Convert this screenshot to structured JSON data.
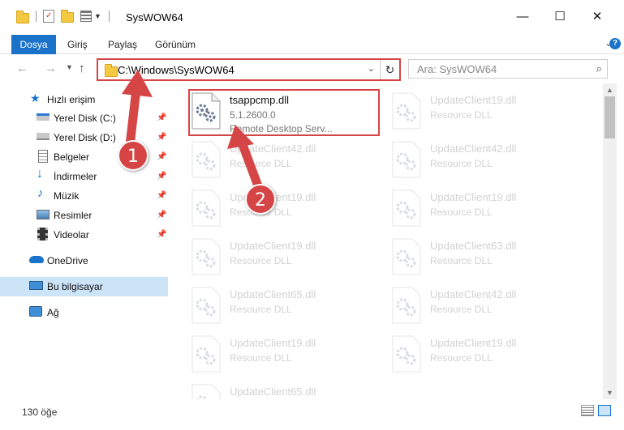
{
  "window": {
    "title": "SysWOW64",
    "minimize_glyph": "—",
    "maximize_glyph": "☐",
    "close_glyph": "✕"
  },
  "ribbon": {
    "tabs": [
      {
        "label": "Dosya",
        "active": true
      },
      {
        "label": "Giriş"
      },
      {
        "label": "Paylaş"
      },
      {
        "label": "Görünüm"
      }
    ],
    "expand_glyph": "⌄",
    "help_glyph": "?"
  },
  "nav": {
    "address": "C:\\Windows\\SysWOW64",
    "search_placeholder": "Ara: SysWOW64"
  },
  "sidebar": {
    "items": [
      {
        "label": "Hızlı erişim",
        "icon": "star-icon"
      },
      {
        "label": "Yerel Disk (C:)",
        "icon": "drive-icon",
        "pinned": true
      },
      {
        "label": "Yerel Disk (D:)",
        "icon": "drive-icon",
        "pinned": true
      },
      {
        "label": "Belgeler",
        "icon": "document-icon",
        "pinned": true
      },
      {
        "label": "İndirmeler",
        "icon": "download-icon",
        "pinned": true
      },
      {
        "label": "Müzik",
        "icon": "music-icon",
        "pinned": true
      },
      {
        "label": "Resimler",
        "icon": "pictures-icon",
        "pinned": true
      },
      {
        "label": "Videolar",
        "icon": "video-icon",
        "pinned": true
      },
      {
        "label": "OneDrive",
        "icon": "cloud-icon"
      },
      {
        "label": "Bu bilgisayar",
        "icon": "computer-icon",
        "selected": true
      },
      {
        "label": "Ağ",
        "icon": "network-icon"
      }
    ]
  },
  "files": {
    "highlighted": {
      "name": "tsappcmp.dll",
      "version": "5.1.2600.0",
      "description": "Remote Desktop Serv..."
    },
    "ghost": [
      {
        "name": "UpdateClient19.dll",
        "desc": "Resource DLL"
      },
      {
        "name": "UpdateClient42.dll",
        "desc": "Resource DLL"
      },
      {
        "name": "UpdateClient42.dll",
        "desc": "Resource DLL"
      },
      {
        "name": "UpdateClient19.dll",
        "desc": "Resource DLL"
      },
      {
        "name": "UpdateClient19.dll",
        "desc": "Resource DLL"
      },
      {
        "name": "UpdateClient19.dll",
        "desc": "Resource DLL"
      },
      {
        "name": "UpdateClient63.dll",
        "desc": "Resource DLL"
      },
      {
        "name": "UpdateClient65.dll",
        "desc": "Resource DLL"
      },
      {
        "name": "UpdateClient42.dll",
        "desc": "Resource DLL"
      },
      {
        "name": "UpdateClient19.dll",
        "desc": "Resource DLL"
      },
      {
        "name": "UpdateClient19.dll",
        "desc": "Resource DLL"
      },
      {
        "name": "UpdateClient65.dll",
        "desc": "Resource DLL"
      }
    ]
  },
  "status": {
    "count": "130 öğe"
  },
  "annotations": {
    "step1": "1",
    "step2": "2",
    "color": "#d64545"
  }
}
